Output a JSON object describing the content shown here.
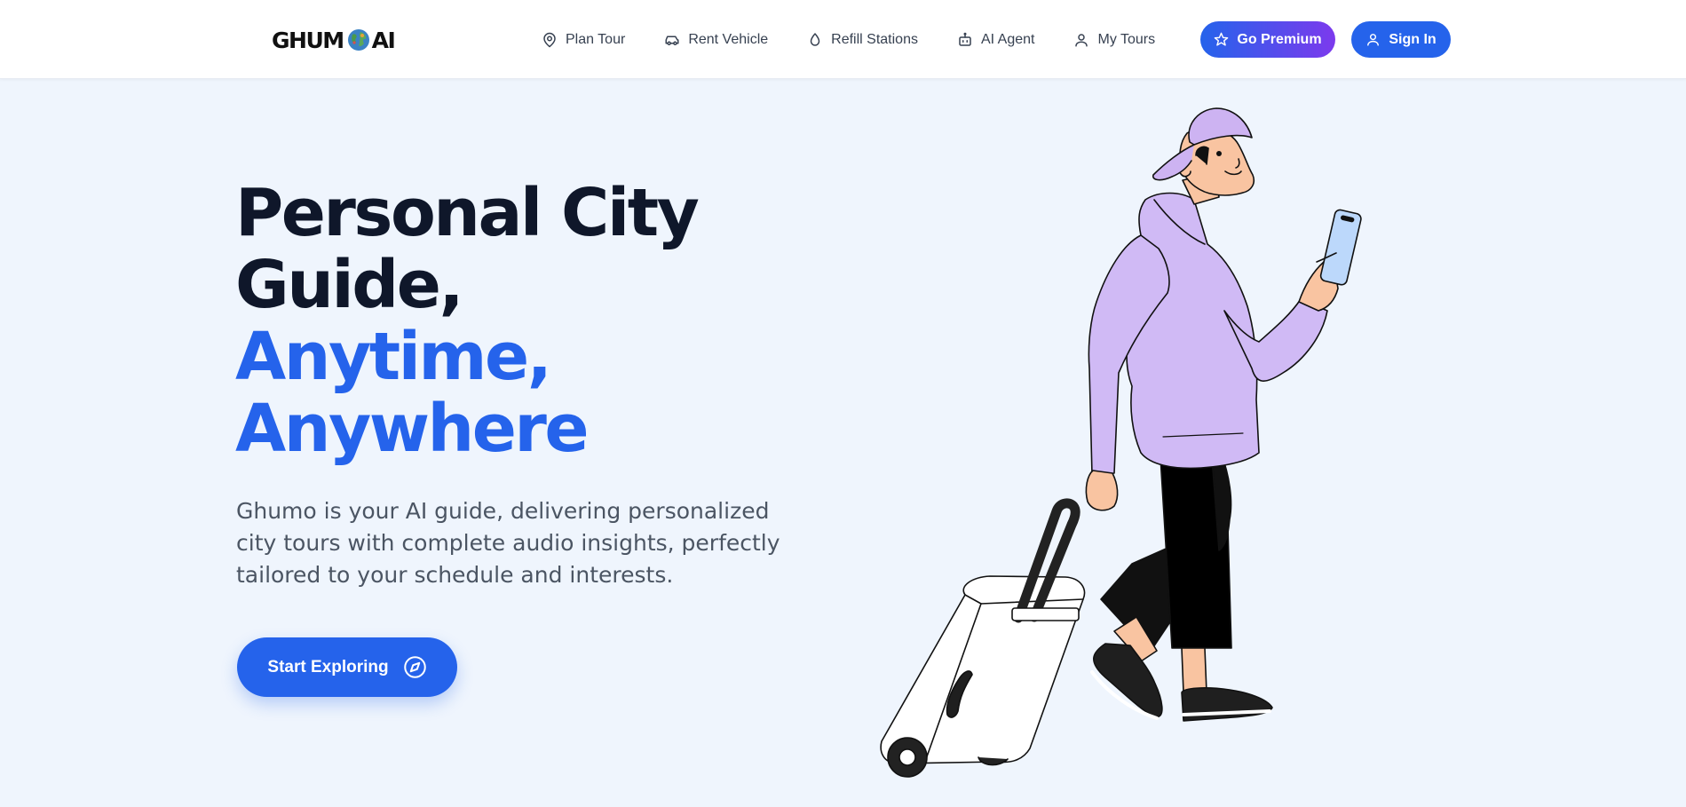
{
  "brand": {
    "logo_left": "GHUM",
    "logo_right": "AI"
  },
  "nav": {
    "items": [
      {
        "label": "Plan Tour",
        "icon": "map-pin-icon"
      },
      {
        "label": "Rent Vehicle",
        "icon": "car-icon"
      },
      {
        "label": "Refill Stations",
        "icon": "droplet-icon"
      },
      {
        "label": "AI Agent",
        "icon": "robot-icon"
      },
      {
        "label": "My Tours",
        "icon": "user-icon"
      }
    ],
    "premium_label": "Go Premium",
    "signin_label": "Sign In"
  },
  "hero": {
    "title_line1": "Personal City",
    "title_line2": "Guide,",
    "title_line3": "Anytime,",
    "title_line4": "Anywhere",
    "subtitle": "Ghumo is your AI guide, delivering personalized city tours with complete audio insights, perfectly tailored to your schedule and interests.",
    "cta_label": "Start Exploring",
    "cta_icon": "compass-icon"
  },
  "colors": {
    "accent": "#2563eb",
    "premium_gradient_start": "#2563eb",
    "premium_gradient_end": "#7c3aed",
    "background": "#eff5fd",
    "heading": "#0f172a"
  }
}
